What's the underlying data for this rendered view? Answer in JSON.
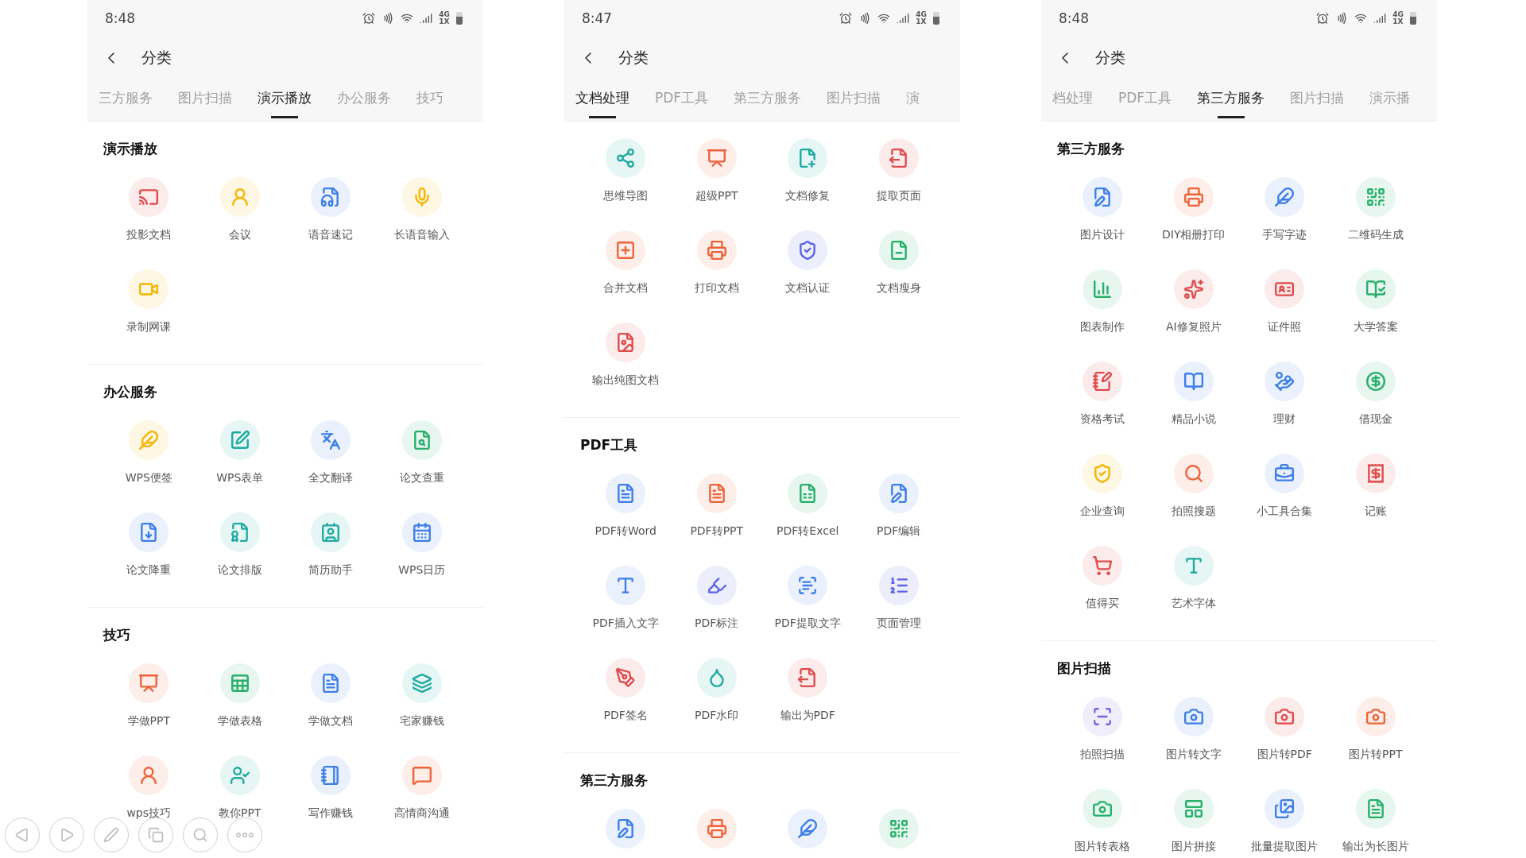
{
  "panels": [
    {
      "status_bar": {
        "time": "8:48",
        "network": [
          "4G",
          "1X"
        ]
      },
      "title": "分类",
      "tabs": [
        {
          "label": "三方服务",
          "selected": false
        },
        {
          "label": "图片扫描",
          "selected": false
        },
        {
          "label": "演示播放",
          "selected": true
        },
        {
          "label": "办公服务",
          "selected": false
        },
        {
          "label": "技巧",
          "selected": false
        }
      ],
      "sections": [
        {
          "title": "演示播放",
          "items": [
            {
              "label": "投影文档",
              "color": "#e04b4b"
            },
            {
              "label": "会议",
              "color": "#f5b400"
            },
            {
              "label": "语音速记",
              "color": "#3d7ee8"
            },
            {
              "label": "长语音输入",
              "color": "#f5b400"
            },
            {
              "label": "录制网课",
              "color": "#f5b400"
            }
          ]
        },
        {
          "title": "办公服务",
          "items": [
            {
              "label": "WPS便签",
              "color": "#f5b400"
            },
            {
              "label": "WPS表单",
              "color": "#1eaaa0"
            },
            {
              "label": "全文翻译",
              "color": "#3d7ee8"
            },
            {
              "label": "论文查重",
              "color": "#26b06a"
            },
            {
              "label": "论文降重",
              "color": "#3d7ee8"
            },
            {
              "label": "论文排版",
              "color": "#1eaaa0"
            },
            {
              "label": "简历助手",
              "color": "#1eaaa0"
            },
            {
              "label": "WPS日历",
              "color": "#3d7ee8"
            }
          ]
        },
        {
          "title": "技巧",
          "items": [
            {
              "label": "学做PPT",
              "color": "#ef6237"
            },
            {
              "label": "学做表格",
              "color": "#26b06a"
            },
            {
              "label": "学做文档",
              "color": "#3d7ee8"
            },
            {
              "label": "宅家赚钱",
              "color": "#1eaaa0"
            },
            {
              "label": "wps技巧",
              "color": "#ef6237"
            },
            {
              "label": "教你PPT",
              "color": "#1eaaa0"
            },
            {
              "label": "写作赚钱",
              "color": "#3d7ee8"
            },
            {
              "label": "高情商沟通",
              "color": "#ef6237"
            }
          ]
        }
      ]
    },
    {
      "status_bar": {
        "time": "8:47",
        "network": [
          "4G",
          "1X"
        ]
      },
      "title": "分类",
      "tabs": [
        {
          "label": "文档处理",
          "selected": true
        },
        {
          "label": "PDF工具",
          "selected": false
        },
        {
          "label": "第三方服务",
          "selected": false
        },
        {
          "label": "图片扫描",
          "selected": false
        },
        {
          "label": "演",
          "selected": false
        }
      ],
      "sections": [
        {
          "items": [
            {
              "label": "思维导图",
              "color": "#1eaaa0"
            },
            {
              "label": "超级PPT",
              "color": "#ef6237"
            },
            {
              "label": "文档修复",
              "color": "#1eaaa0"
            },
            {
              "label": "提取页面",
              "color": "#e04b4b"
            },
            {
              "label": "合并文档",
              "color": "#ef6237"
            },
            {
              "label": "打印文档",
              "color": "#ef6237"
            },
            {
              "label": "文档认证",
              "color": "#5b63e8"
            },
            {
              "label": "文档瘦身",
              "color": "#26b06a"
            },
            {
              "label": "输出纯图文档",
              "color": "#e04b4b"
            }
          ]
        },
        {
          "title": "PDF工具",
          "items": [
            {
              "label": "PDF转Word",
              "color": "#3d7ee8"
            },
            {
              "label": "PDF转PPT",
              "color": "#ef6237"
            },
            {
              "label": "PDF转Excel",
              "color": "#26b06a"
            },
            {
              "label": "PDF编辑",
              "color": "#3d7ee8"
            },
            {
              "label": "PDF插入文字",
              "color": "#3d7ee8"
            },
            {
              "label": "PDF标注",
              "color": "#5b63e8"
            },
            {
              "label": "PDF提取文字",
              "color": "#3d7ee8"
            },
            {
              "label": "页面管理",
              "color": "#5b63e8"
            },
            {
              "label": "PDF签名",
              "color": "#e04b4b"
            },
            {
              "label": "PDF水印",
              "color": "#1eaaa0"
            },
            {
              "label": "输出为PDF",
              "color": "#e04b4b"
            }
          ]
        },
        {
          "title": "第三方服务",
          "items": [
            {
              "color": "#3d7ee8"
            },
            {
              "color": "#ef6237"
            },
            {
              "color": "#3d7ee8"
            },
            {
              "color": "#26b06a"
            }
          ]
        }
      ]
    },
    {
      "status_bar": {
        "time": "8:48",
        "network": [
          "4G",
          "1X"
        ]
      },
      "title": "分类",
      "tabs": [
        {
          "label": "档处理",
          "selected": false
        },
        {
          "label": "PDF工具",
          "selected": false
        },
        {
          "label": "第三方服务",
          "selected": true
        },
        {
          "label": "图片扫描",
          "selected": false
        },
        {
          "label": "演示播",
          "selected": false
        }
      ],
      "sections": [
        {
          "title": "第三方服务",
          "items": [
            {
              "label": "图片设计",
              "color": "#3d7ee8"
            },
            {
              "label": "DIY相册打印",
              "color": "#ef6237"
            },
            {
              "label": "手写字迹",
              "color": "#3d7ee8"
            },
            {
              "label": "二维码生成",
              "color": "#26b06a"
            },
            {
              "label": "图表制作",
              "color": "#26b06a"
            },
            {
              "label": "AI修复照片",
              "color": "#e04b4b"
            },
            {
              "label": "证件照",
              "color": "#e04b4b"
            },
            {
              "label": "大学答案",
              "color": "#26b06a"
            },
            {
              "label": "资格考试",
              "color": "#e04b4b"
            },
            {
              "label": "精品小说",
              "color": "#3d7ee8"
            },
            {
              "label": "理财",
              "color": "#3d7ee8"
            },
            {
              "label": "借现金",
              "color": "#26b06a"
            },
            {
              "label": "企业查询",
              "color": "#f5b400"
            },
            {
              "label": "拍照搜题",
              "color": "#ef6237"
            },
            {
              "label": "小工具合集",
              "color": "#3d7ee8"
            },
            {
              "label": "记账",
              "color": "#e04b4b"
            },
            {
              "label": "值得买",
              "color": "#e04b4b"
            },
            {
              "label": "艺术字体",
              "color": "#1eaaa0"
            }
          ]
        },
        {
          "title": "图片扫描",
          "items": [
            {
              "label": "拍照扫描",
              "color": "#7b61e0"
            },
            {
              "label": "图片转文字",
              "color": "#3d7ee8"
            },
            {
              "label": "图片转PDF",
              "color": "#e04b4b"
            },
            {
              "label": "图片转PPT",
              "color": "#ef6237"
            },
            {
              "label": "图片转表格",
              "color": "#26b06a"
            },
            {
              "label": "图片拼接",
              "color": "#26b06a"
            },
            {
              "label": "批量提取图片",
              "color": "#3d7ee8"
            },
            {
              "label": "输出为长图片",
              "color": "#26b06a"
            }
          ]
        }
      ]
    }
  ]
}
